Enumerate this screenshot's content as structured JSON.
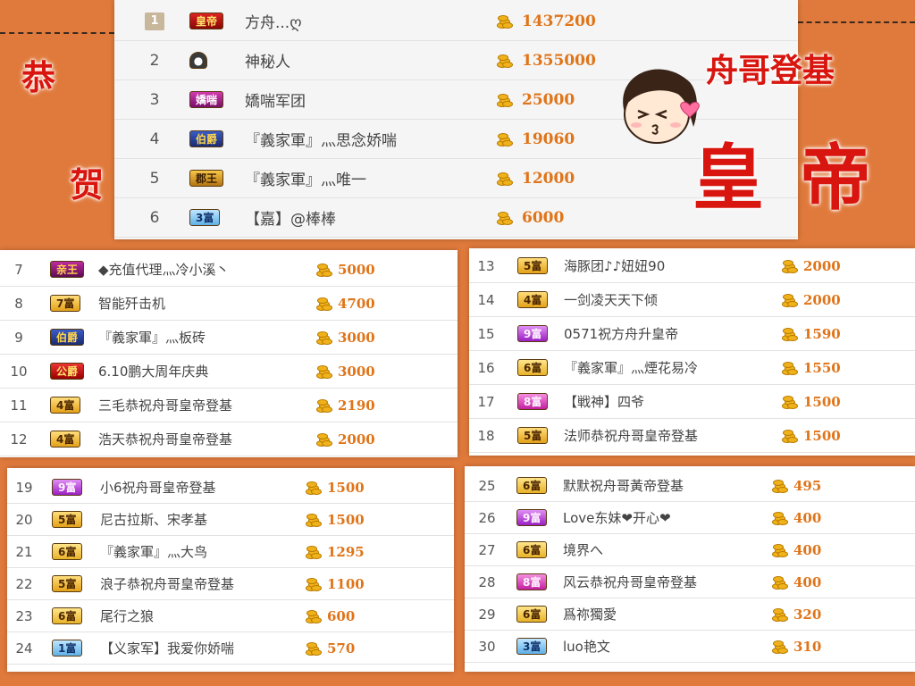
{
  "decorations": {
    "left_char_1": "恭",
    "left_char_2": "贺",
    "right_line_1": "舟哥登基",
    "right_line_2": "皇 帝"
  },
  "colors": {
    "background": "#e07a3c",
    "amount_orange": "#e07418",
    "deco_red": "#d8150e"
  },
  "icons": {
    "coin": "gold-coin-stack-icon",
    "face": "kissing-girl-sticker-icon"
  },
  "top_panel": [
    {
      "rank": "1",
      "badge": "皇帝",
      "badge_style": "emperor",
      "name": "方舟...ღ",
      "amount": "1437200"
    },
    {
      "rank": "2",
      "badge": "",
      "badge_style": "mystery",
      "name": "神秘人",
      "amount": "1355000"
    },
    {
      "rank": "3",
      "badge": "嬌喘",
      "badge_style": "cute",
      "name": "嬌喘军团",
      "amount": "25000"
    },
    {
      "rank": "4",
      "badge": "伯爵",
      "badge_style": "earl",
      "name": "『義家軍』灬思念娇喘",
      "amount": "19060"
    },
    {
      "rank": "5",
      "badge": "郡王",
      "badge_style": "prince",
      "name": "『義家軍』灬唯一",
      "amount": "12000"
    },
    {
      "rank": "6",
      "badge": "3富",
      "badge_style": "rich3",
      "name": "【嘉】@棒棒",
      "amount": "6000"
    }
  ],
  "panel_a": [
    {
      "rank": "7",
      "badge": "亲王",
      "badge_style": "king",
      "name": "◆充值代理灬冷小溪丶",
      "amount": "5000"
    },
    {
      "rank": "8",
      "badge": "7富",
      "badge_style": "rich7",
      "name": "智能歼击机",
      "amount": "4700"
    },
    {
      "rank": "9",
      "badge": "伯爵",
      "badge_style": "earl",
      "name": "『義家軍』灬板砖",
      "amount": "3000"
    },
    {
      "rank": "10",
      "badge": "公爵",
      "badge_style": "duke",
      "name": "6.10鹏大周年庆典",
      "amount": "3000"
    },
    {
      "rank": "11",
      "badge": "4富",
      "badge_style": "rich4",
      "name": "三毛恭祝舟哥皇帝登基",
      "amount": "2190"
    },
    {
      "rank": "12",
      "badge": "4富",
      "badge_style": "rich4",
      "name": "浩天恭祝舟哥皇帝登基",
      "amount": "2000"
    }
  ],
  "panel_b": [
    {
      "rank": "13",
      "badge": "5富",
      "badge_style": "rich5",
      "name": "海豚团♪♪妞妞90",
      "amount": "2000"
    },
    {
      "rank": "14",
      "badge": "4富",
      "badge_style": "rich4",
      "name": "一剑凌天天下倾",
      "amount": "2000"
    },
    {
      "rank": "15",
      "badge": "9富",
      "badge_style": "rich9",
      "name": "0571祝方舟升皇帝",
      "amount": "1590"
    },
    {
      "rank": "16",
      "badge": "6富",
      "badge_style": "rich6",
      "name": "『義家軍』灬煙花易冷",
      "amount": "1550"
    },
    {
      "rank": "17",
      "badge": "8富",
      "badge_style": "rich8",
      "name": "【戦神】四爷",
      "amount": "1500"
    },
    {
      "rank": "18",
      "badge": "5富",
      "badge_style": "rich5",
      "name": "法师恭祝舟哥皇帝登基",
      "amount": "1500"
    }
  ],
  "panel_c": [
    {
      "rank": "19",
      "badge": "9富",
      "badge_style": "rich9",
      "name": "小6祝舟哥皇帝登基",
      "amount": "1500"
    },
    {
      "rank": "20",
      "badge": "5富",
      "badge_style": "rich5",
      "name": "尼古拉斯、宋孝基",
      "amount": "1500"
    },
    {
      "rank": "21",
      "badge": "6富",
      "badge_style": "rich6",
      "name": "『義家軍』灬大鸟",
      "amount": "1295"
    },
    {
      "rank": "22",
      "badge": "5富",
      "badge_style": "rich5",
      "name": "浪子恭祝舟哥皇帝登基",
      "amount": "1100"
    },
    {
      "rank": "23",
      "badge": "6富",
      "badge_style": "rich6",
      "name": "尾行之狼",
      "amount": "600"
    },
    {
      "rank": "24",
      "badge": "1富",
      "badge_style": "rich1",
      "name": "【义家军】我爱你娇喘",
      "amount": "570"
    }
  ],
  "panel_d": [
    {
      "rank": "25",
      "badge": "6富",
      "badge_style": "rich6",
      "name": "默默祝舟哥黃帝登基",
      "amount": "495"
    },
    {
      "rank": "26",
      "badge": "9富",
      "badge_style": "rich9",
      "name": "Love东妹❤开心❤",
      "amount": "400"
    },
    {
      "rank": "27",
      "badge": "6富",
      "badge_style": "rich6",
      "name": "境界へ",
      "amount": "400"
    },
    {
      "rank": "28",
      "badge": "8富",
      "badge_style": "rich8",
      "name": "风云恭祝舟哥皇帝登基",
      "amount": "400"
    },
    {
      "rank": "29",
      "badge": "6富",
      "badge_style": "rich6",
      "name": "爲祢獨愛",
      "amount": "320"
    },
    {
      "rank": "30",
      "badge": "3富",
      "badge_style": "rich3",
      "name": "luo艳文",
      "amount": "310"
    }
  ]
}
